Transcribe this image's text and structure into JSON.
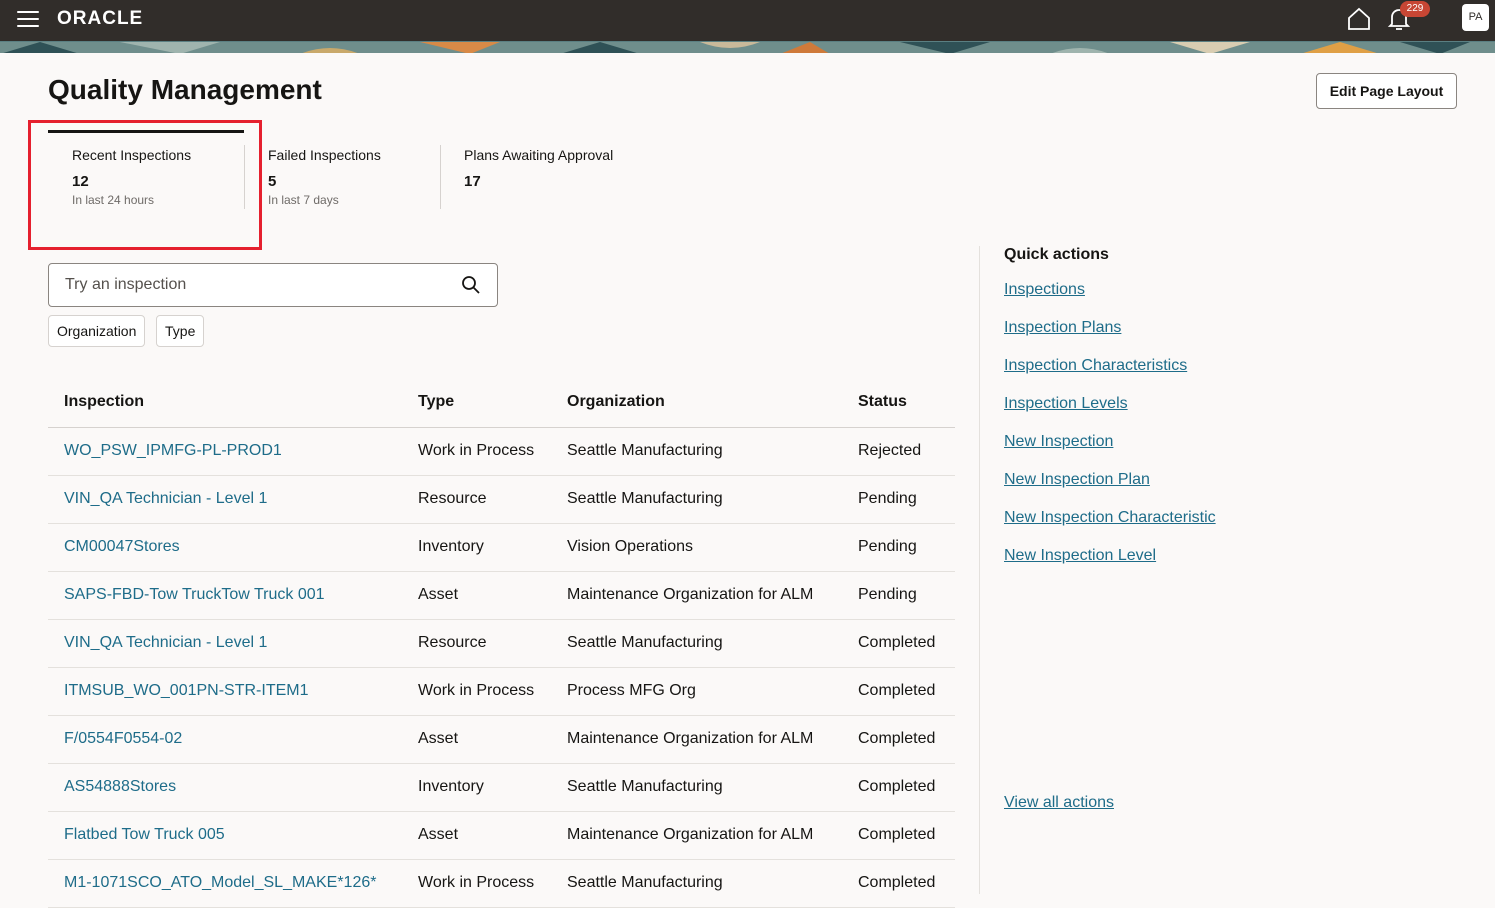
{
  "header": {
    "logo": "ORACLE",
    "notifications_count": "229",
    "user_initials": "PA"
  },
  "page": {
    "title": "Quality Management",
    "edit_layout_label": "Edit Page Layout"
  },
  "metrics": [
    {
      "label": "Recent Inspections",
      "value": "12",
      "sub": "In last 24 hours"
    },
    {
      "label": "Failed Inspections",
      "value": "5",
      "sub": "In last 7 days"
    },
    {
      "label": "Plans Awaiting Approval",
      "value": "17"
    }
  ],
  "search": {
    "placeholder": "Try an inspection"
  },
  "filters": {
    "organization": "Organization",
    "type": "Type"
  },
  "table": {
    "headers": {
      "inspection": "Inspection",
      "type": "Type",
      "organization": "Organization",
      "status": "Status"
    },
    "rows": [
      {
        "inspection": "WO_PSW_IPMFG-PL-PROD1",
        "type": "Work in Process",
        "organization": "Seattle Manufacturing",
        "status": "Rejected"
      },
      {
        "inspection": "VIN_QA Technician - Level 1",
        "type": "Resource",
        "organization": "Seattle Manufacturing",
        "status": "Pending"
      },
      {
        "inspection": "CM00047Stores",
        "type": "Inventory",
        "organization": "Vision Operations",
        "status": "Pending"
      },
      {
        "inspection": "SAPS-FBD-Tow TruckTow Truck 001",
        "type": "Asset",
        "organization": "Maintenance Organization for ALM",
        "status": "Pending"
      },
      {
        "inspection": "VIN_QA Technician - Level 1",
        "type": "Resource",
        "organization": "Seattle Manufacturing",
        "status": "Completed"
      },
      {
        "inspection": "ITMSUB_WO_001PN-STR-ITEM1",
        "type": "Work in Process",
        "organization": "Process MFG Org",
        "status": "Completed"
      },
      {
        "inspection": "F/0554F0554-02",
        "type": "Asset",
        "organization": "Maintenance Organization for ALM",
        "status": "Completed"
      },
      {
        "inspection": "AS54888Stores",
        "type": "Inventory",
        "organization": "Seattle Manufacturing",
        "status": "Completed"
      },
      {
        "inspection": "Flatbed Tow Truck 005",
        "type": "Asset",
        "organization": "Maintenance Organization for ALM",
        "status": "Completed"
      },
      {
        "inspection": "M1-1071SCO_ATO_Model_SL_MAKE*126*",
        "type": "Work in Process",
        "organization": "Seattle Manufacturing",
        "status": "Completed"
      }
    ]
  },
  "quick_actions": {
    "title": "Quick actions",
    "links": [
      "Inspections",
      "Inspection Plans",
      "Inspection Characteristics",
      "Inspection Levels",
      "New Inspection",
      "New Inspection Plan",
      "New Inspection Characteristic",
      "New Inspection Level"
    ],
    "view_all": "View all actions"
  },
  "colors": {
    "topbar": "#312d2a",
    "link": "#1e6c89",
    "highlight": "#e5202e",
    "badge": "#c74634"
  }
}
